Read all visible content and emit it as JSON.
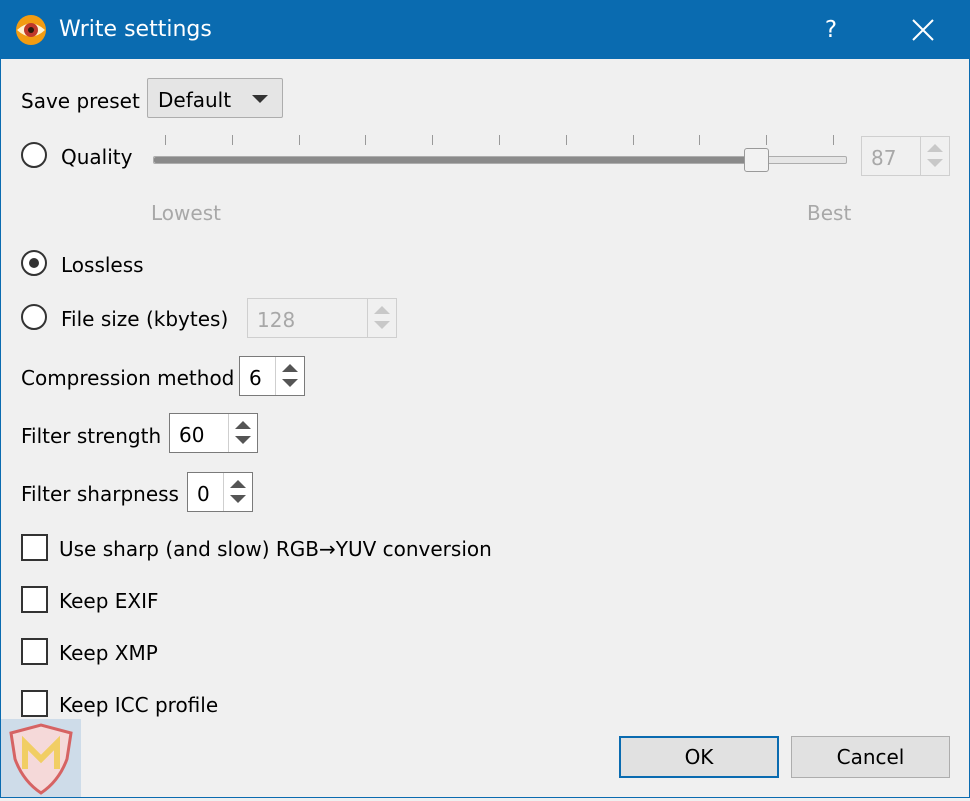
{
  "window": {
    "title": "Write settings",
    "help_label": "?"
  },
  "preset": {
    "label": "Save preset",
    "value": "Default"
  },
  "quality": {
    "label": "Quality",
    "selected": false,
    "value": "87",
    "slider_fraction": 0.87,
    "min_label": "Lowest",
    "max_label": "Best"
  },
  "lossless": {
    "label": "Lossless",
    "selected": true
  },
  "filesize": {
    "label": "File size (kbytes)",
    "selected": false,
    "value": "128"
  },
  "compression": {
    "label": "Compression method",
    "value": "6"
  },
  "filter_strength": {
    "label": "Filter strength",
    "value": "60"
  },
  "filter_sharpness": {
    "label": "Filter sharpness",
    "value": "0"
  },
  "checkboxes": [
    {
      "label": "Use sharp (and slow) RGB→YUV conversion",
      "checked": false
    },
    {
      "label": "Keep EXIF",
      "checked": false
    },
    {
      "label": "Keep XMP",
      "checked": false
    },
    {
      "label": "Keep ICC profile",
      "checked": false
    }
  ],
  "buttons": {
    "ok": "OK",
    "cancel": "Cancel"
  },
  "colors": {
    "titlebar": "#0a6bb0",
    "background": "#f0f0f0"
  }
}
